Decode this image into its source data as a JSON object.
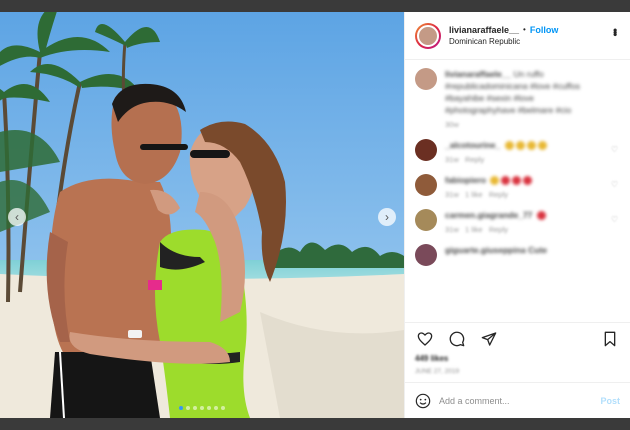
{
  "header": {
    "username": "livianaraffaele__",
    "separator": "•",
    "follow_label": "Follow",
    "location": "Dominican Republic"
  },
  "caption": {
    "username": "livianaraffaele__",
    "text": "Un ruffo #republicadominicana #love #cuffos #bayahibe #sexin #love #photographyhave #belmare #cio",
    "time": "30w"
  },
  "comments": [
    {
      "username": "_alcotourine_",
      "time": "31w",
      "reply_label": "Reply",
      "avatar_color": "#6b2f22",
      "emojis": [
        "#e8b833",
        "#e8b833",
        "#e8b833",
        "#e8b833"
      ]
    },
    {
      "username": "fabiopiero",
      "time": "31w",
      "likes": "1 like",
      "reply_label": "Reply",
      "avatar_color": "#8f5b3a",
      "emojis": [
        "#e8b833",
        "#d9333f",
        "#d9333f",
        "#d9333f"
      ]
    },
    {
      "username": "carmen.giagrande_77",
      "time": "31w",
      "likes": "1 like",
      "reply_label": "Reply",
      "avatar_color": "#a58a5a",
      "emojis": [
        "#d9333f"
      ]
    },
    {
      "username": "giguarte.giuseppina Cute",
      "time": "",
      "likes": "",
      "reply_label": "",
      "avatar_color": "#7a4a5a",
      "emojis": []
    }
  ],
  "actions": {
    "like_icon": "heart-outline-icon",
    "comment_icon": "comment-bubble-icon",
    "share_icon": "paper-plane-icon",
    "save_icon": "bookmark-icon"
  },
  "likes_text": "449 likes",
  "date_text": "JUNE 27, 2019",
  "add_comment": {
    "placeholder": "Add a comment...",
    "post_label": "Post",
    "emoji_icon": "smiley-icon"
  },
  "carousel": {
    "prev_glyph": "‹",
    "next_glyph": "›",
    "dot_count": 7,
    "active_index": 0
  },
  "colors": {
    "follow": "#0095f6",
    "post_disabled": "#b2dffc",
    "active_dot": "#3897f0"
  }
}
